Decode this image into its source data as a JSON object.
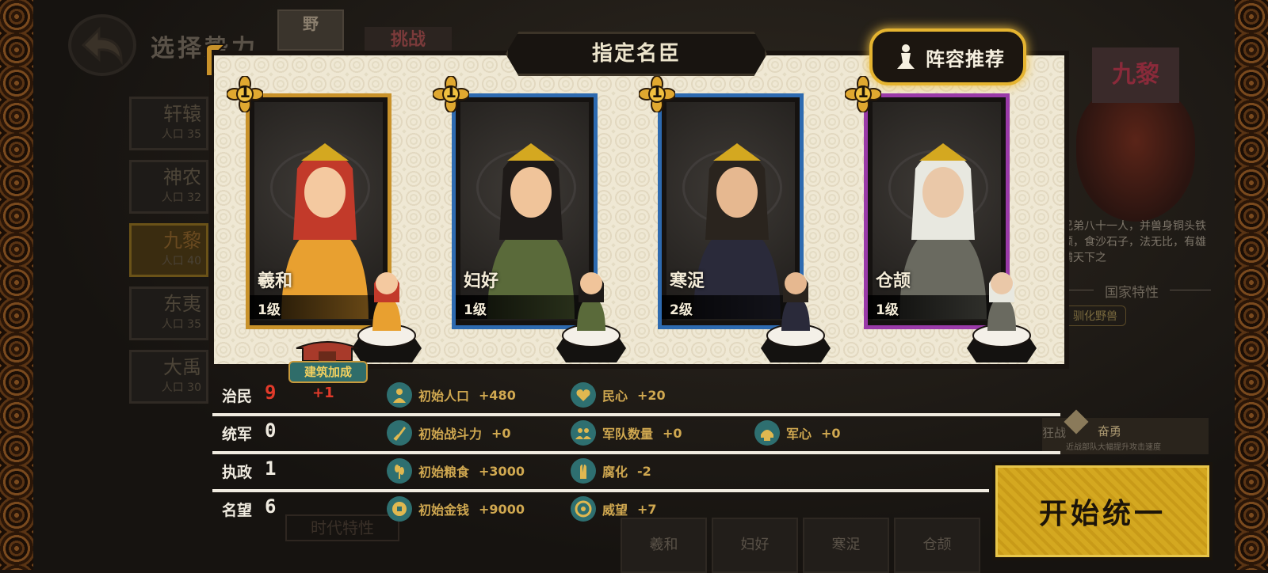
{
  "background": {
    "screen_title": "选择势力",
    "top_badge": "野",
    "challenge_label": "挑战",
    "factions": [
      {
        "name": "轩辕",
        "sub": "人口 35"
      },
      {
        "name": "神农",
        "sub": "人口 32"
      },
      {
        "name": "九黎",
        "sub": "人口 40",
        "selected": true
      },
      {
        "name": "东夷",
        "sub": "人口 35"
      },
      {
        "name": "大禹",
        "sub": "人口 30"
      }
    ],
    "right_panel": {
      "flag_text": "九黎",
      "description": "兄弟八十一人，并兽身铜头铁额，食沙石子，法无比，有雄霸天下之",
      "trait_title": "国家特性",
      "trait_badge": "驯化野兽",
      "skill_name": "狂战",
      "skill_title": "奋勇",
      "skill_desc": "近战部队大幅提升攻击速度"
    },
    "bottom_tabs": [
      "羲和",
      "妇好",
      "寒浞",
      "仓颉"
    ],
    "faded_bottom_label": "时代特性"
  },
  "modal": {
    "title": "指定名臣",
    "recommend_label": "阵容推荐",
    "ministers": [
      {
        "name": "羲和",
        "level": "1级",
        "star": "1",
        "border": "#c9922a"
      },
      {
        "name": "妇好",
        "level": "1级",
        "star": "1",
        "border": "#2d6ab0"
      },
      {
        "name": "寒浞",
        "level": "2级",
        "star": "1",
        "border": "#2d6ab0"
      },
      {
        "name": "仓颉",
        "level": "1级",
        "star": "1",
        "border": "#9a3aa8"
      }
    ],
    "building_bonus_label": "建筑加成"
  },
  "stats": [
    {
      "label": "治民",
      "value": "9",
      "value_red": true,
      "bonus": "+1",
      "effects": [
        {
          "icon": "population-icon",
          "name": "初始人口",
          "value": "+480"
        },
        {
          "icon": "heart-icon",
          "name": "民心",
          "value": "+20"
        }
      ]
    },
    {
      "label": "统军",
      "value": "0",
      "effects": [
        {
          "icon": "combat-power-icon",
          "name": "初始战斗力",
          "value": "+0"
        },
        {
          "icon": "troops-icon",
          "name": "军队数量",
          "value": "+0"
        },
        {
          "icon": "morale-icon",
          "name": "军心",
          "value": "+0"
        }
      ]
    },
    {
      "label": "执政",
      "value": "1",
      "effects": [
        {
          "icon": "grain-icon",
          "name": "初始粮食",
          "value": "+3000"
        },
        {
          "icon": "corruption-icon",
          "name": "腐化",
          "value": "-2"
        }
      ]
    },
    {
      "label": "名望",
      "value": "6",
      "effects": [
        {
          "icon": "coin-icon",
          "name": "初始金钱",
          "value": "+9000"
        },
        {
          "icon": "prestige-icon",
          "name": "威望",
          "value": "+7"
        }
      ]
    }
  ],
  "start_button_label": "开始统一",
  "colors": {
    "gold": "#d4a820",
    "teal": "#2e6f70",
    "red": "#e23a2a",
    "effect_text": "#d0a850"
  }
}
